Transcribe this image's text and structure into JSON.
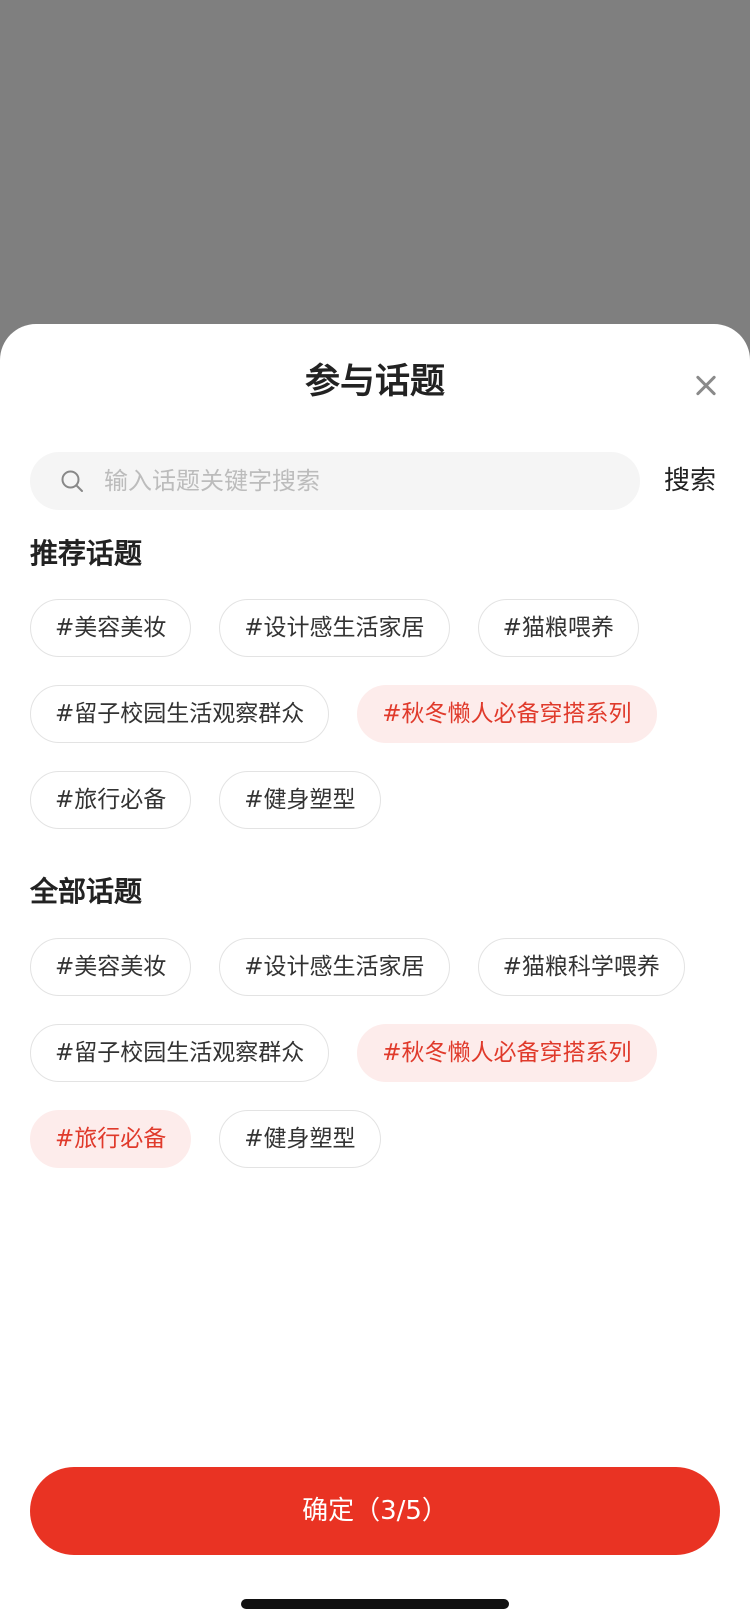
{
  "sheet": {
    "title": "参与话题",
    "close_icon": "close-icon"
  },
  "search": {
    "placeholder": "输入话题关键字搜索",
    "value": "",
    "button_label": "搜索",
    "icon": "search-icon"
  },
  "recommended": {
    "title": "推荐话题",
    "tags": [
      {
        "label": "#美容美妆",
        "selected": false
      },
      {
        "label": "#设计感生活家居",
        "selected": false
      },
      {
        "label": "#猫粮喂养",
        "selected": false
      },
      {
        "label": "#留子校园生活观察群众",
        "selected": false
      },
      {
        "label": "#秋冬懒人必备穿搭系列",
        "selected": true
      },
      {
        "label": "#旅行必备",
        "selected": false
      },
      {
        "label": "#健身塑型",
        "selected": false
      }
    ]
  },
  "all": {
    "title": "全部话题",
    "tags": [
      {
        "label": "#美容美妆",
        "selected": false
      },
      {
        "label": "#设计感生活家居",
        "selected": false
      },
      {
        "label": "#猫粮科学喂养",
        "selected": false
      },
      {
        "label": "#留子校园生活观察群众",
        "selected": false
      },
      {
        "label": "#秋冬懒人必备穿搭系列",
        "selected": true
      },
      {
        "label": "#旅行必备",
        "selected": true
      },
      {
        "label": "#健身塑型",
        "selected": false
      }
    ]
  },
  "confirm": {
    "label": "确定（3/5）"
  },
  "colors": {
    "accent": "#e93323",
    "tag_selected_bg": "#fdeceb",
    "tag_selected_text": "#e03a2b",
    "backdrop": "#7f7f7f"
  }
}
